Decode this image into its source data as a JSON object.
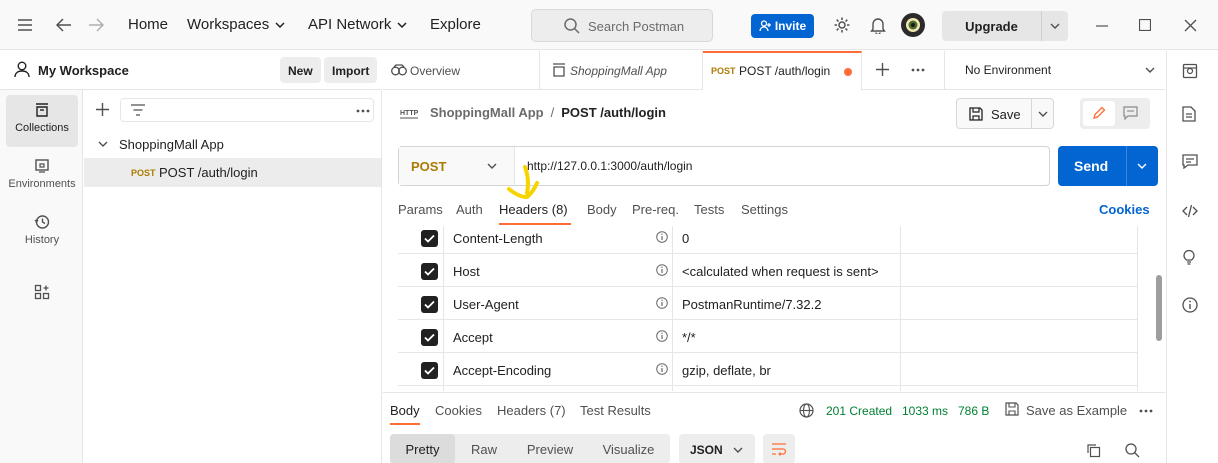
{
  "topbar": {
    "nav": [
      "Home",
      "Workspaces",
      "API Network",
      "Explore"
    ],
    "search_placeholder": "Search Postman",
    "invite_label": "Invite",
    "upgrade_label": "Upgrade"
  },
  "workspace": {
    "title": "My Workspace",
    "new_label": "New",
    "import_label": "Import"
  },
  "rail": {
    "items": [
      {
        "label": "Collections",
        "icon": "collections-icon"
      },
      {
        "label": "Environments",
        "icon": "environments-icon"
      },
      {
        "label": "History",
        "icon": "history-icon"
      },
      {
        "label": "",
        "icon": "apps-grid-icon"
      }
    ]
  },
  "sidebar": {
    "collection": "ShoppingMall App",
    "request_method": "POST",
    "request_name": "POST /auth/login"
  },
  "tabs": {
    "overview": "Overview",
    "collection": "ShoppingMall App",
    "active_method": "POST",
    "active_name": "POST /auth/login",
    "environment": "No Environment"
  },
  "request": {
    "breadcrumb_parent": "ShoppingMall App",
    "breadcrumb_sep": "/",
    "breadcrumb_current": "POST /auth/login",
    "save_label": "Save",
    "method": "POST",
    "url": "http://127.0.0.1:3000/auth/login",
    "send_label": "Send",
    "tabs": [
      "Params",
      "Auth",
      "Headers (8)",
      "Body",
      "Pre-req.",
      "Tests",
      "Settings"
    ],
    "cookies_label": "Cookies",
    "headers": [
      {
        "key": "Content-Length",
        "value": "0"
      },
      {
        "key": "Host",
        "value": "<calculated when request is sent>"
      },
      {
        "key": "User-Agent",
        "value": "PostmanRuntime/7.32.2"
      },
      {
        "key": "Accept",
        "value": "*/*"
      },
      {
        "key": "Accept-Encoding",
        "value": "gzip, deflate, br"
      }
    ]
  },
  "response": {
    "tabs": [
      "Body",
      "Cookies",
      "Headers (7)",
      "Test Results"
    ],
    "status": "201 Created",
    "time": "1033 ms",
    "size": "786 B",
    "save_example_label": "Save as Example",
    "formats": [
      "Pretty",
      "Raw",
      "Preview",
      "Visualize"
    ],
    "language": "JSON"
  },
  "colors": {
    "accent": "#ff6c37",
    "primary": "#0265d2",
    "post_method": "#ad7a03",
    "status_ok": "#007f31",
    "annotation_arrow": "#f5d400"
  }
}
